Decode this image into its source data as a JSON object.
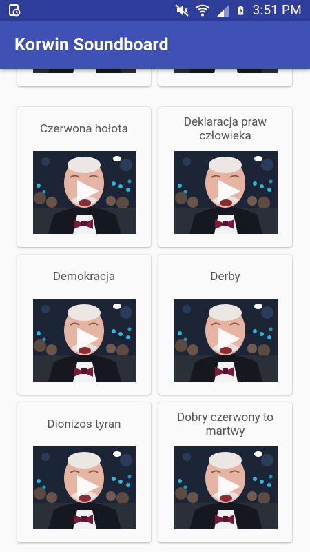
{
  "status_bar": {
    "time": "3:51 PM",
    "icons": [
      "screenshot-icon",
      "mute-icon",
      "wifi-icon",
      "signal-icon",
      "battery-charging-icon"
    ]
  },
  "app_bar": {
    "title": "Korwin Soundboard"
  },
  "sounds": [
    {
      "label": ""
    },
    {
      "label": ""
    },
    {
      "label": "Czerwona hołota"
    },
    {
      "label": "Deklaracja praw człowieka"
    },
    {
      "label": "Demokracja"
    },
    {
      "label": "Derby"
    },
    {
      "label": "Dionizos tyran"
    },
    {
      "label": "Dobry czerwony to martwy"
    }
  ],
  "colors": {
    "status_bar": "#2f3d9b",
    "app_bar": "#3f51b5",
    "background": "#fafafa"
  }
}
